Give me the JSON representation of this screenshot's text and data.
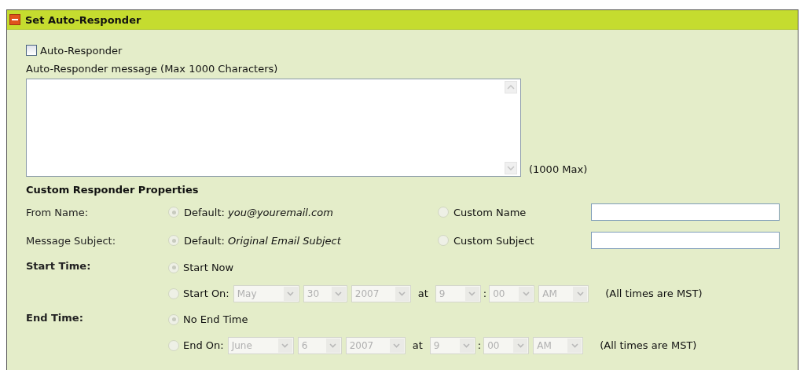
{
  "panel": {
    "title": "Set Auto-Responder",
    "expanded": true
  },
  "auto_responder": {
    "label": "Auto-Responder",
    "checked": false
  },
  "message": {
    "label": "Auto-Responder message (Max 1000 Characters)",
    "max_note": "(1000 Max)"
  },
  "properties": {
    "heading": "Custom Responder Properties",
    "choices": [
      {
        "label": "From Name:",
        "options": [
          {
            "text": "Default: *you@youremail.com*",
            "selected": true,
            "disabled": true
          },
          {
            "text": "Custom Name",
            "selected": false,
            "disabled": true
          }
        ]
      },
      {
        "label": "Message Subject:",
        "options": [
          {
            "text": "Default: *Original Email Subject*",
            "selected": true,
            "disabled": true
          },
          {
            "text": "Custom Subject",
            "selected": false,
            "disabled": true
          }
        ]
      }
    ],
    "schedule": [
      {
        "label": "Start Time:",
        "options": [
          {
            "kind": "plain",
            "text": "Start Now",
            "selected": true,
            "disabled": true
          },
          {
            "kind": "date",
            "text": "Start On:",
            "selected": false,
            "disabled": true,
            "month": "May",
            "day": "30",
            "year": "2007",
            "at": "at",
            "hour": "9",
            "colon": ":",
            "minute": "00",
            "ampm": "AM",
            "note": "(All times are MST)"
          }
        ]
      },
      {
        "label": "End Time:",
        "options": [
          {
            "kind": "plain",
            "text": "No End Time",
            "selected": true,
            "disabled": true
          },
          {
            "kind": "date",
            "text": "End On:",
            "selected": false,
            "disabled": true,
            "month": "June",
            "day": "6",
            "year": "2007",
            "at": "at",
            "hour": "9",
            "colon": ":",
            "minute": "00",
            "ampm": "AM",
            "note": "(All times are MST)"
          }
        ]
      }
    ]
  }
}
